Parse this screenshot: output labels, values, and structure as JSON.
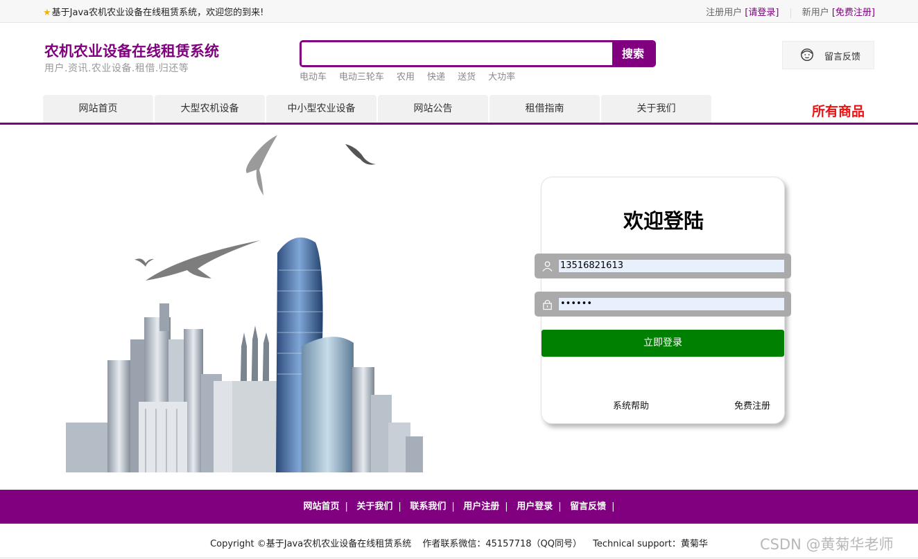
{
  "topbar": {
    "welcome": "基于Java农机农业设备在线租赁系统，欢迎您的到来!",
    "register_user": "注册用户",
    "please_login": "[请登录]",
    "new_user": "新用户",
    "free_register": "[免费注册]"
  },
  "header": {
    "title": "农机农业设备在线租赁系统",
    "subtitle": "用户.资讯.农业设备.租借.归还等",
    "search_button": "搜索",
    "hot_words": [
      "电动车",
      "电动三轮车",
      "农用",
      "快递",
      "送货",
      "大功率"
    ],
    "feedback": "留言反馈"
  },
  "nav": {
    "tabs": [
      "网站首页",
      "大型农机设备",
      "中小型农业设备",
      "网站公告",
      "租借指南",
      "关于我们"
    ],
    "all_goods": "所有商品"
  },
  "login": {
    "title": "欢迎登陆",
    "username_value": "13516821613",
    "password_value": "••••••",
    "submit": "立即登录",
    "help": "系统帮助",
    "register": "免费注册"
  },
  "footer": {
    "links": [
      "网站首页",
      "关于我们",
      "联系我们",
      "用户注册",
      "用户登录",
      "留言反馈"
    ],
    "copyright": "Copyright ©基于Java农机农业设备在线租赁系统",
    "contact": "作者联系微信：45157718（QQ同号）",
    "support": "Technical support：黄菊华"
  },
  "watermark": "CSDN @黄菊华老师",
  "colors": {
    "brand": "#800080",
    "login_button": "#008000",
    "all_goods": "#ee1111"
  }
}
